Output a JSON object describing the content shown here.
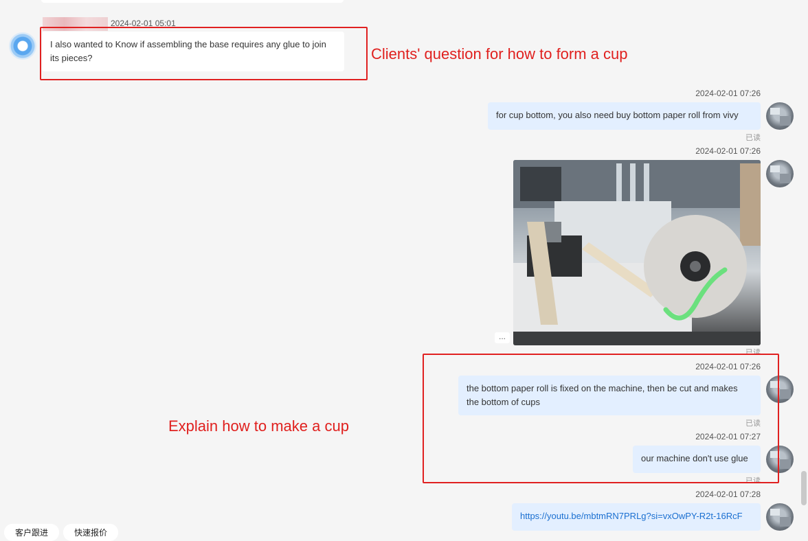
{
  "messages": {
    "m1": {
      "timestamp": "2024-02-01 05:01",
      "text": "I also wanted to Know if assembling the base requires any glue to join its pieces?"
    },
    "m2": {
      "timestamp": "2024-02-01 07:26",
      "text": "for cup bottom, you also need buy bottom paper roll from vivy",
      "status": "已读"
    },
    "m3": {
      "timestamp": "2024-02-01 07:26",
      "status": "已读",
      "more": "..."
    },
    "m4": {
      "timestamp": "2024-02-01 07:26",
      "text": "the bottom paper roll is fixed on the machine, then be cut and makes the bottom of cups",
      "status": "已读"
    },
    "m5": {
      "timestamp": "2024-02-01 07:27",
      "text": "our machine don't use glue",
      "status": "已读"
    },
    "m6": {
      "timestamp": "2024-02-01 07:28",
      "link": "https://youtu.be/mbtmRN7PRLg?si=vxOwPY-R2t-16RcF"
    }
  },
  "annotations": {
    "client_question": "Clients' question for how to form a cup",
    "explain": "Explain how to make a cup"
  },
  "bottom_bar": {
    "follow_up": "客户跟进",
    "quick_quote": "快速报价"
  },
  "colors": {
    "annotation_red": "#e0201e",
    "outgoing_bubble": "#e3efff",
    "link": "#1a6fd0"
  }
}
